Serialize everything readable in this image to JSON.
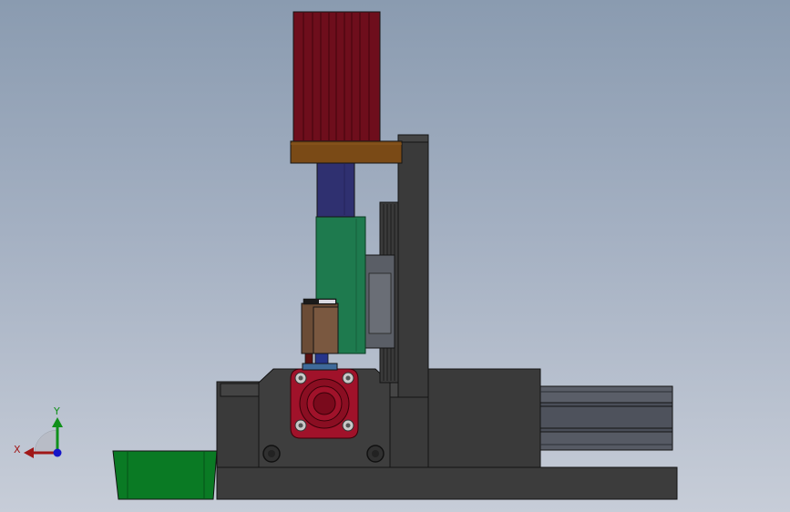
{
  "viewport": {
    "background_top": "#8a9bb0",
    "background_bottom": "#c7cdd8"
  },
  "model": {
    "motor_color": "#6e0e1c",
    "motor_rib_color": "#4a0610",
    "flange_color": "#7a4a16",
    "coupling_color": "#2f3070",
    "gearbox_color": "#1e7a4e",
    "frame_color": "#3c3c3c",
    "frame_edge_color": "#141414",
    "bearing_color": "#a0122a",
    "block_color": "#6b4c36",
    "tray_color": "#0a7a24",
    "cylinder_color": "#4a4e58"
  },
  "triad": {
    "x_label": "X",
    "y_label": "Y",
    "x_color": "#a01818",
    "y_color": "#10901a",
    "z_color": "#1616c8"
  }
}
